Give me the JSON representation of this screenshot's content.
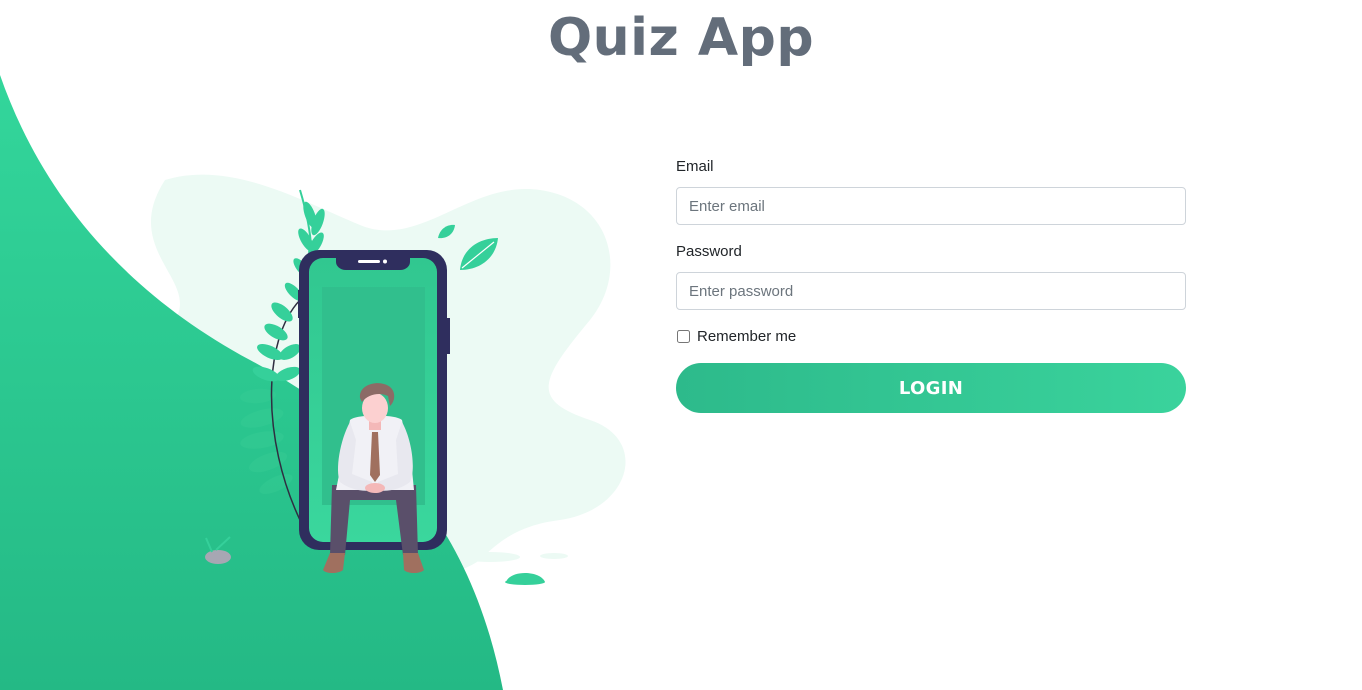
{
  "header": {
    "title": "Quiz App"
  },
  "form": {
    "email_label": "Email",
    "email_placeholder": "Enter email",
    "email_value": "",
    "password_label": "Password",
    "password_placeholder": "Enter password",
    "password_value": "",
    "remember_label": "Remember me",
    "remember_checked": false,
    "login_label": "LOGIN"
  },
  "colors": {
    "brand_green": "#2ecc8f",
    "title_gray": "#636d7a",
    "phone_frame": "#2f2e5e"
  },
  "illustration": {
    "icons": [
      "person-sitting-illustration",
      "phone-illustration",
      "leaf-icon",
      "plant-icon"
    ]
  }
}
